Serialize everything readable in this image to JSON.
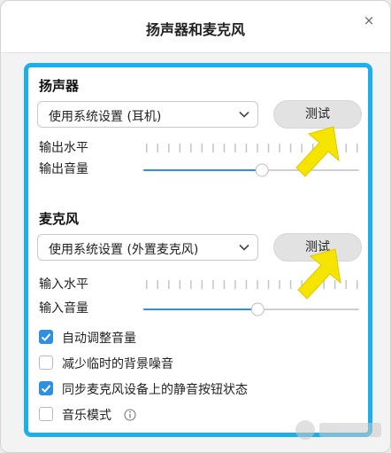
{
  "dialog": {
    "title": "扬声器和麦克风",
    "close_glyph": "×"
  },
  "speaker": {
    "section_title": "扬声器",
    "device_selected": "使用系统设置 (耳机)",
    "test_label": "测试",
    "output_level_label": "输出水平",
    "output_volume_label": "输出音量",
    "output_volume_fraction": 0.55
  },
  "microphone": {
    "section_title": "麦克风",
    "device_selected": "使用系统设置 (外置麦克风)",
    "test_label": "测试",
    "input_level_label": "输入水平",
    "input_volume_label": "输入音量",
    "input_volume_fraction": 0.53
  },
  "options": [
    {
      "label": "自动调整音量",
      "checked": true
    },
    {
      "label": "减少临时的背景噪音",
      "checked": false
    },
    {
      "label": "同步麦克风设备上的静音按钮状态",
      "checked": true
    },
    {
      "label": "音乐模式",
      "checked": false,
      "info": true
    }
  ],
  "colors": {
    "accent": "#2f8fe0",
    "highlight_border": "#1ab0f0",
    "annotation_arrow": "#f5e400"
  },
  "icons": {
    "close": "close-icon",
    "dropdown": "chevron-down-icon",
    "info": "info-icon",
    "check": "checkmark-icon",
    "annotation": "arrow-annotation-icon"
  }
}
